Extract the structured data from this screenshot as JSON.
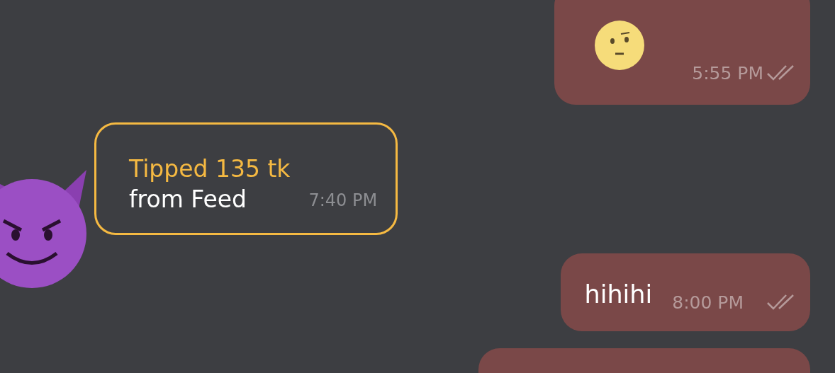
{
  "messages": [
    {
      "kind": "emoji",
      "time": "5:55 PM",
      "read": true
    },
    {
      "kind": "tip",
      "title": "Tipped 135 tk",
      "text": "from Feed",
      "time": "7:40 PM"
    },
    {
      "kind": "text",
      "text": "hihihi",
      "time": "8:00 PM",
      "read": true
    },
    {
      "kind": "partial"
    }
  ]
}
